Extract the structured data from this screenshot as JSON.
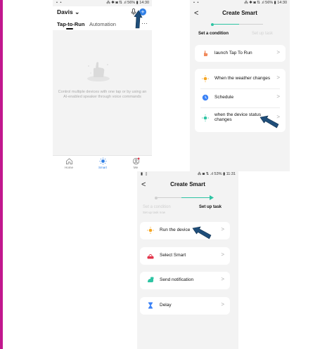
{
  "phone1": {
    "status_left": "• •",
    "status_right": "⁂ ✱ ◙ ⇅ .ıl 56% ▮ 14:30",
    "home_name": "Davis",
    "tabs": [
      "Tap-to-Run",
      "Automation"
    ],
    "more": "···",
    "plus": "+",
    "empty_text": "Control multiple devices with one tap or by using an AI-enabled speaker through voice commands",
    "nav": [
      {
        "label": "Home",
        "icon": "home-icon"
      },
      {
        "label": "Smart",
        "icon": "sun-icon"
      },
      {
        "label": "Me",
        "icon": "person-icon"
      }
    ]
  },
  "phone2": {
    "status_left": "• •",
    "status_right": "⁂ ✱ ◙ ⇅ .ıl 56% ▮ 14:30",
    "back": "<",
    "title": "Create Smart",
    "step1": "Set a condition",
    "step2": "Set up task",
    "rows": [
      {
        "label": "launch Tap To Run",
        "icon": "hand-tap-icon"
      },
      {
        "label": "When the weather changes",
        "icon": "sun-icon"
      },
      {
        "label": "Schedule",
        "icon": "clock-icon"
      },
      {
        "label": "when the device status changes",
        "icon": "device-status-icon"
      }
    ],
    "chevron": ">"
  },
  "phone3": {
    "status_left": "▮ ▯",
    "status_right": "⁂ ◙ ⇅ .ıl 53% ▮ 11:31",
    "back": "<",
    "title": "Create Smart",
    "step1": "Set a condition",
    "step1_sub": "Set up task now",
    "step2": "Set up task",
    "rows": [
      {
        "label": "Run the device",
        "icon": "sun-icon"
      },
      {
        "label": "Select Smart",
        "icon": "smart-icon"
      },
      {
        "label": "Send notification",
        "icon": "notification-icon"
      },
      {
        "label": "Delay",
        "icon": "hourglass-icon"
      }
    ],
    "chevron": ">"
  },
  "colors": {
    "accent": "#2f7fe6",
    "teal": "#2ec4a3",
    "sun": "#f5a623",
    "pointer_arrow": "#1f4e7a",
    "side_bar": "#c2188e"
  }
}
